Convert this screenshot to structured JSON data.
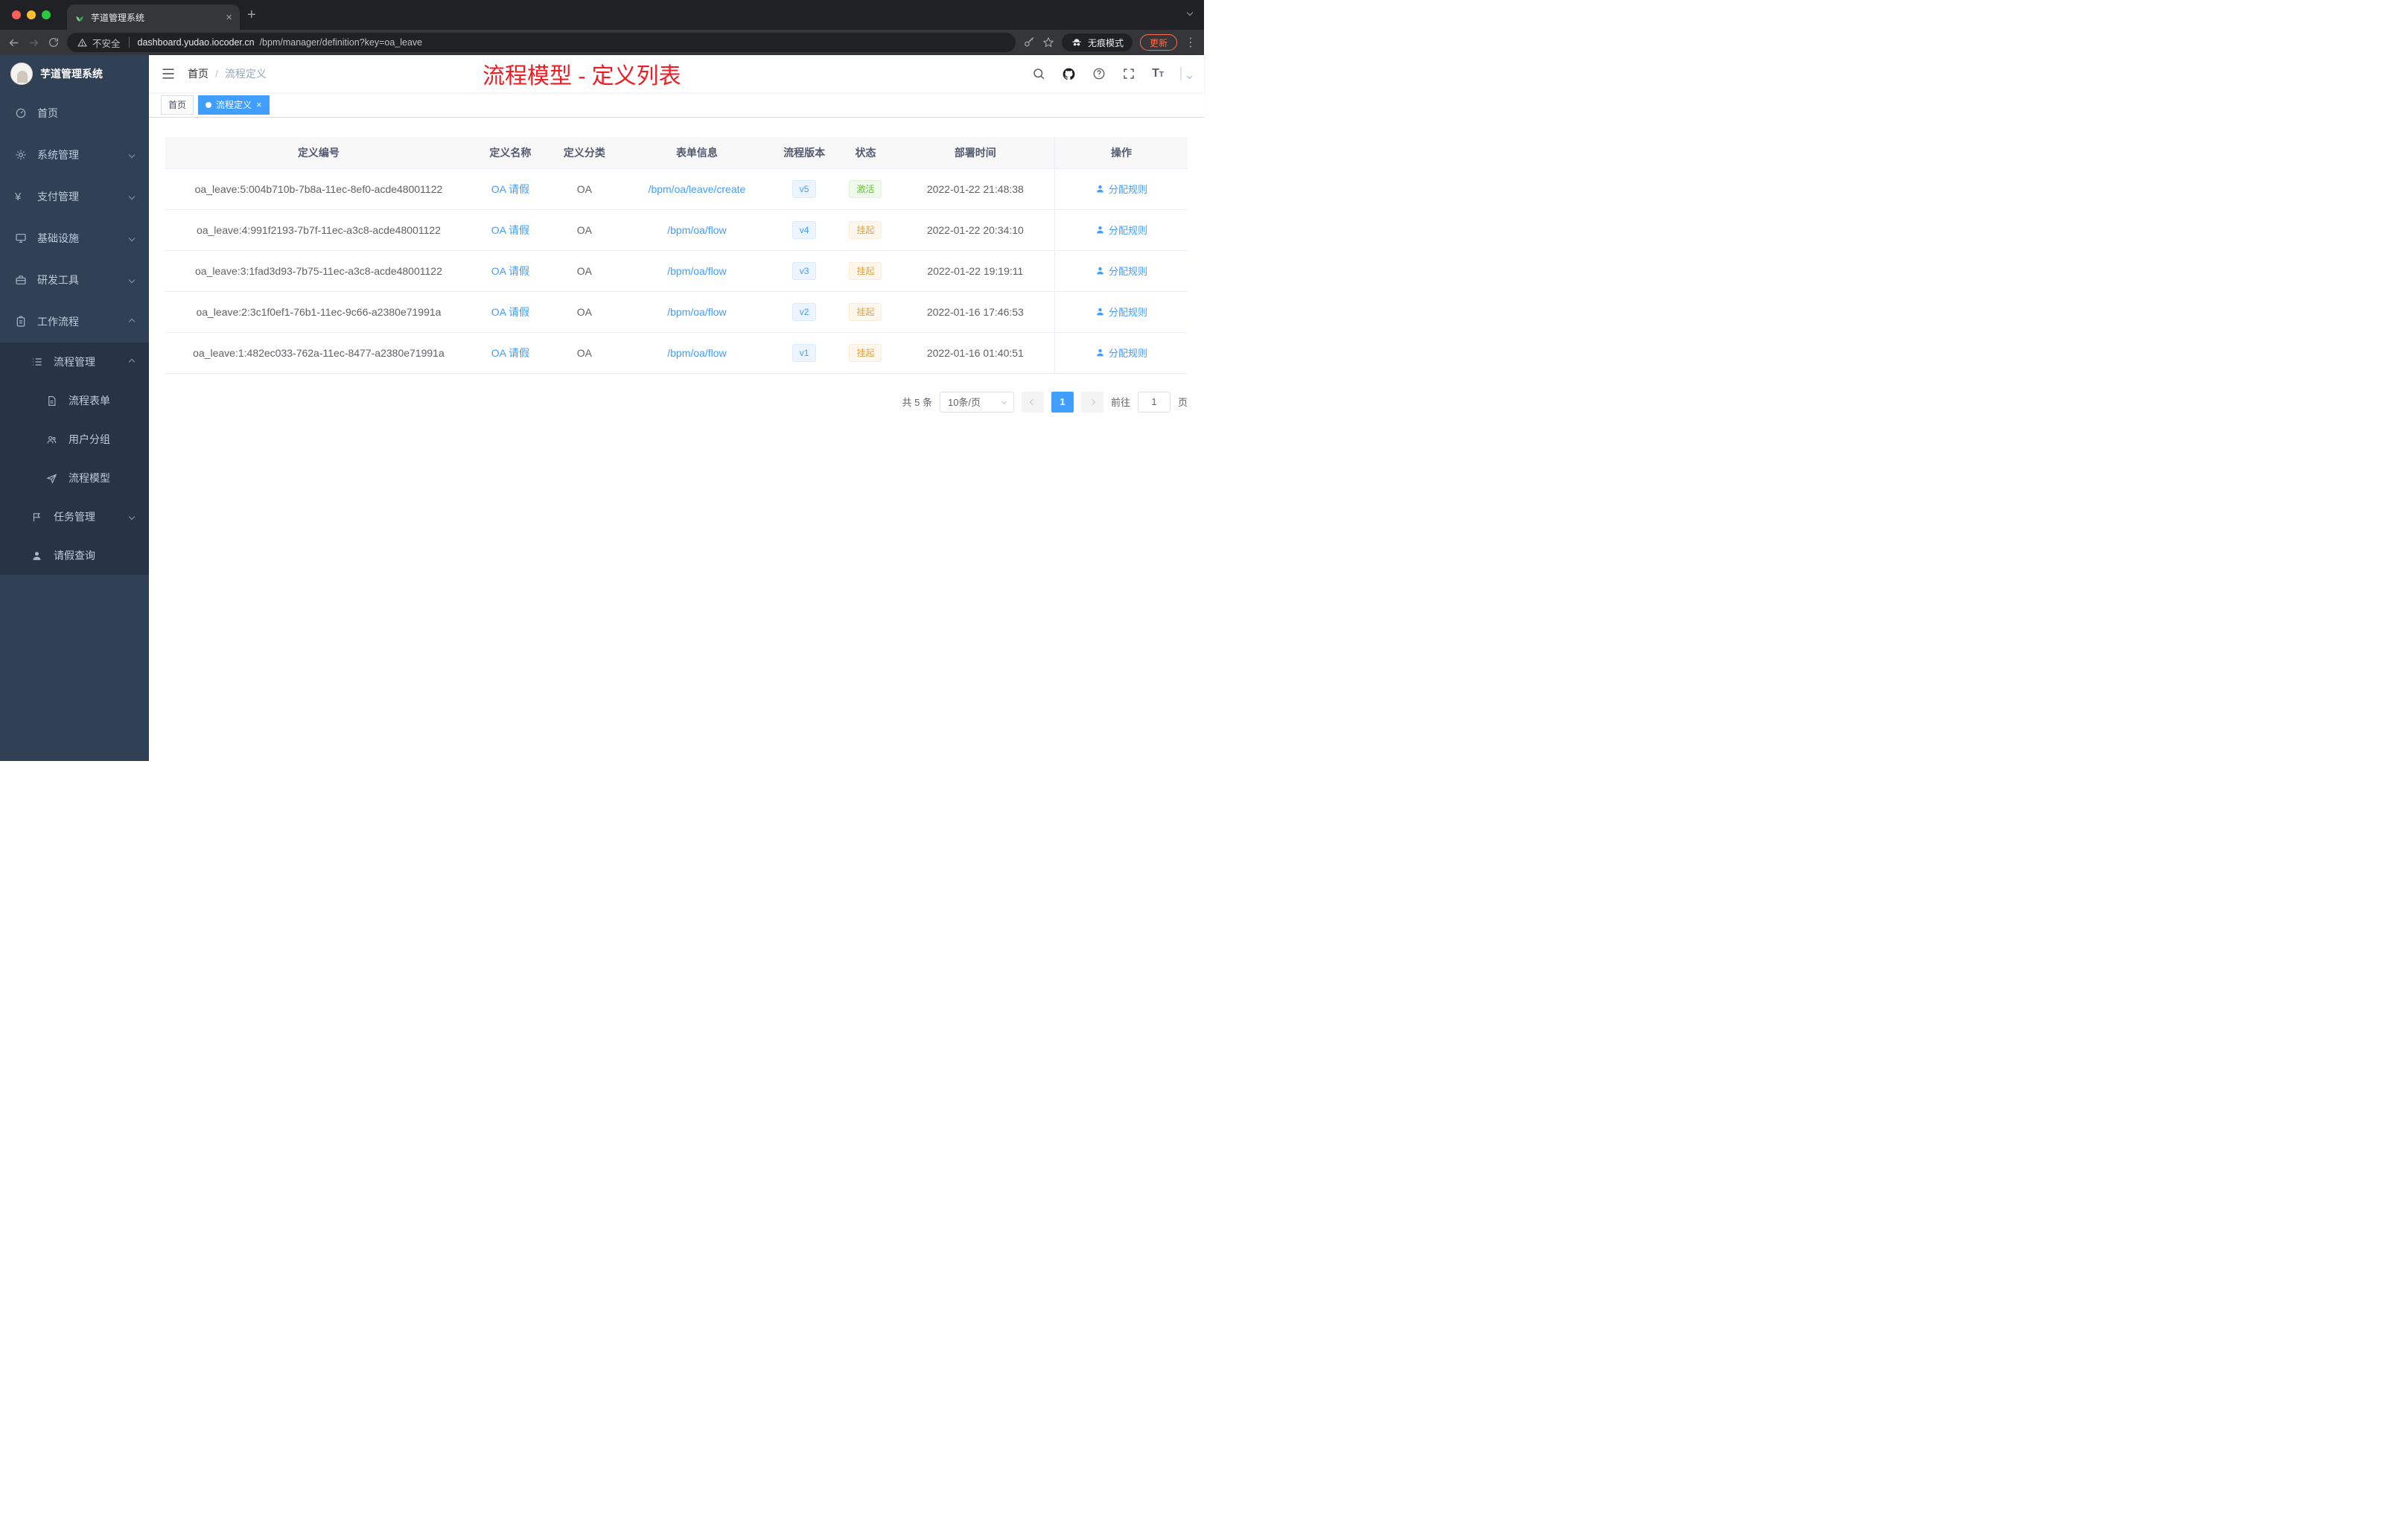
{
  "colors": {
    "accent": "#409eff",
    "sidebar_bg": "#304156",
    "submenu_bg": "#263445",
    "annotation_red": "#ec1e24",
    "status_active": "#67c23a",
    "status_suspended": "#e6a23c",
    "update_button": "#ff6d4d"
  },
  "browser": {
    "tab": {
      "title": "芋道管理系统"
    },
    "toolbar": {
      "security_label": "不安全",
      "url_host": "dashboard.yudao.iocoder.cn",
      "url_path": "/bpm/manager/definition?key=oa_leave",
      "incognito_label": "无痕模式",
      "update_label": "更新"
    }
  },
  "sidebar": {
    "title": "芋道管理系统",
    "items": [
      {
        "label": "首页",
        "icon": "dashboard-icon"
      },
      {
        "label": "系统管理",
        "icon": "gear-icon"
      },
      {
        "label": "支付管理",
        "icon": "yen-icon"
      },
      {
        "label": "基础设施",
        "icon": "monitor-icon"
      },
      {
        "label": "研发工具",
        "icon": "toolbox-icon"
      },
      {
        "label": "工作流程",
        "icon": "briefcase-icon"
      }
    ],
    "process_mgmt": {
      "label": "流程管理",
      "children": [
        {
          "label": "流程表单",
          "icon": "document-icon"
        },
        {
          "label": "用户分组",
          "icon": "users-icon"
        },
        {
          "label": "流程模型",
          "icon": "paper-plane-icon"
        }
      ]
    },
    "task_mgmt": {
      "label": "任务管理"
    },
    "leave_query": {
      "label": "请假查询"
    }
  },
  "header": {
    "breadcrumb": [
      "首页",
      "流程定义"
    ],
    "annotation": "流程模型 - 定义列表"
  },
  "tags": [
    {
      "label": "首页",
      "active": false
    },
    {
      "label": "流程定义",
      "active": true
    }
  ],
  "table": {
    "columns": [
      "定义编号",
      "定义名称",
      "定义分类",
      "表单信息",
      "流程版本",
      "状态",
      "部署时间",
      "操作"
    ],
    "rows": [
      {
        "id": "oa_leave:5:004b710b-7b8a-11ec-8ef0-acde48001122",
        "name": "OA 请假",
        "category": "OA",
        "form": "/bpm/oa/leave/create",
        "version": "v5",
        "status": "激活",
        "status_type": "active",
        "deploy_time": "2022-01-22 21:48:38",
        "action_label": "分配规则"
      },
      {
        "id": "oa_leave:4:991f2193-7b7f-11ec-a3c8-acde48001122",
        "name": "OA 请假",
        "category": "OA",
        "form": "/bpm/oa/flow",
        "version": "v4",
        "status": "挂起",
        "status_type": "suspended",
        "deploy_time": "2022-01-22 20:34:10",
        "action_label": "分配规则"
      },
      {
        "id": "oa_leave:3:1fad3d93-7b75-11ec-a3c8-acde48001122",
        "name": "OA 请假",
        "category": "OA",
        "form": "/bpm/oa/flow",
        "version": "v3",
        "status": "挂起",
        "status_type": "suspended",
        "deploy_time": "2022-01-22 19:19:11",
        "action_label": "分配规则"
      },
      {
        "id": "oa_leave:2:3c1f0ef1-76b1-11ec-9c66-a2380e71991a",
        "name": "OA 请假",
        "category": "OA",
        "form": "/bpm/oa/flow",
        "version": "v2",
        "status": "挂起",
        "status_type": "suspended",
        "deploy_time": "2022-01-16 17:46:53",
        "action_label": "分配规则"
      },
      {
        "id": "oa_leave:1:482ec033-762a-11ec-8477-a2380e71991a",
        "name": "OA 请假",
        "category": "OA",
        "form": "/bpm/oa/flow",
        "version": "v1",
        "status": "挂起",
        "status_type": "suspended",
        "deploy_time": "2022-01-16 01:40:51",
        "action_label": "分配规则"
      }
    ]
  },
  "pagination": {
    "total_label": "共 5 条",
    "page_size_label": "10条/页",
    "current_page": "1",
    "goto_label": "前往",
    "goto_value": "1",
    "page_unit_label": "页"
  }
}
